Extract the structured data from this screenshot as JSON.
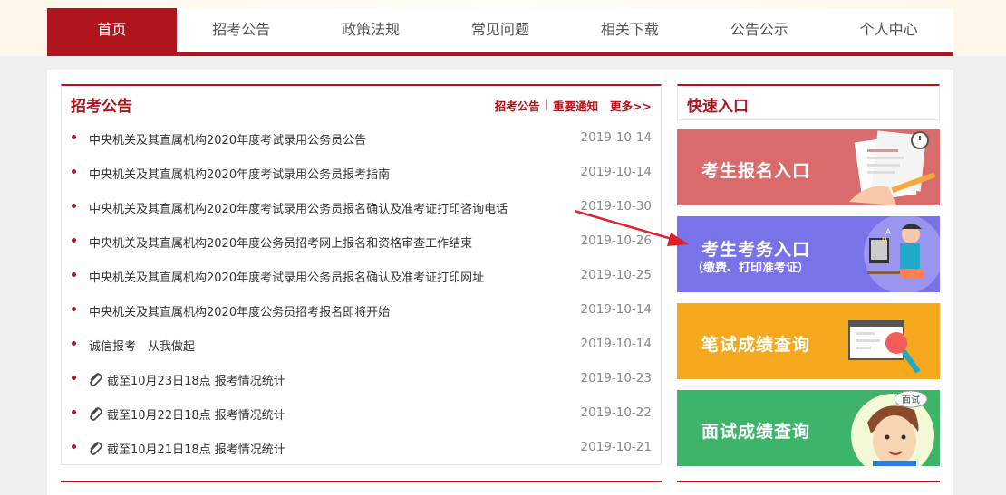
{
  "nav": {
    "items": [
      "首页",
      "招考公告",
      "政策法规",
      "常见问题",
      "相关下载",
      "公告公示",
      "个人中心"
    ],
    "active_index": 0
  },
  "announcements": {
    "title": "招考公告",
    "links": [
      "招考公告",
      "重要通知"
    ],
    "separator": "|",
    "more": "更多>>",
    "items": [
      {
        "text": "中央机关及其直属机构2020年度考试录用公务员公告",
        "date": "2019-10-14",
        "attachment": false
      },
      {
        "text": "中央机关及其直属机构2020年度考试录用公务员报考指南",
        "date": "2019-10-14",
        "attachment": false
      },
      {
        "text": "中央机关及其直属机构2020年度考试录用公务员报名确认及准考证打印咨询电话",
        "date": "2019-10-30",
        "attachment": false
      },
      {
        "text": "中央机关及其直属机构2020年度公务员招考网上报名和资格审查工作结束",
        "date": "2019-10-26",
        "attachment": false
      },
      {
        "text": "中央机关及其直属机构2020年度考试录用公务员报名确认及准考证打印网址",
        "date": "2019-10-25",
        "attachment": false
      },
      {
        "text": "中央机关及其直属机构2020年度公务员招考报名即将开始",
        "date": "2019-10-14",
        "attachment": false
      },
      {
        "text": "诚信报考　从我做起",
        "date": "2019-10-14",
        "attachment": false
      },
      {
        "text": "截至10月23日18点 报考情况统计",
        "date": "2019-10-23",
        "attachment": true
      },
      {
        "text": "截至10月22日18点 报考情况统计",
        "date": "2019-10-22",
        "attachment": true
      },
      {
        "text": "截至10月21日18点 报考情况统计",
        "date": "2019-10-21",
        "attachment": true
      }
    ]
  },
  "quick": {
    "title": "快速入口",
    "buttons": [
      {
        "label": "考生报名入口",
        "sub": "",
        "color": "#d96b6c"
      },
      {
        "label": "考生考务入口",
        "sub": "（缴费、打印准考证）",
        "color": "#7873e8"
      },
      {
        "label": "笔试成绩查询",
        "sub": "",
        "color": "#f5a81c"
      },
      {
        "label": "面试成绩查询",
        "sub": "",
        "color": "#3eb36a"
      }
    ],
    "badge": "面试"
  },
  "colors": {
    "brand": "#b0151d",
    "annotation_arrow": "#e0202a"
  }
}
